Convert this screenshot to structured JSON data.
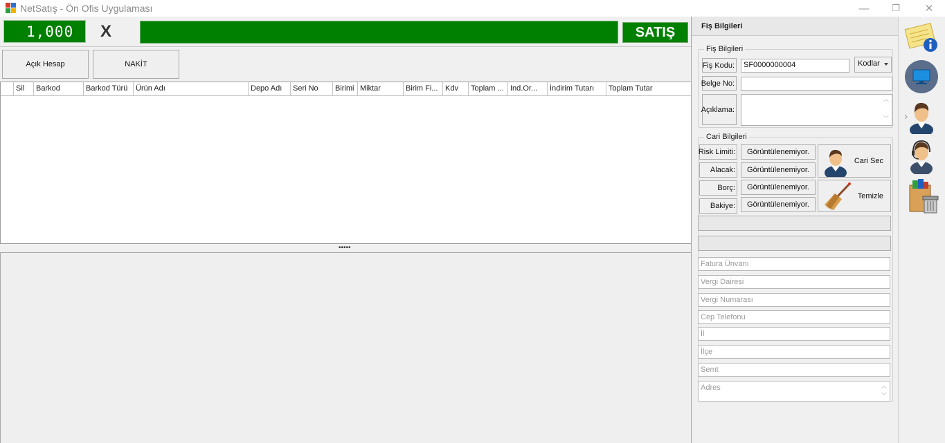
{
  "window": {
    "title": "NetSatış - Ön Ofis Uygulaması",
    "minimize_glyph": "—",
    "restore_glyph": "❐",
    "close_glyph": "✕"
  },
  "sale": {
    "quantity_display": "1,000",
    "multiply_symbol": "X",
    "barcode_value": "",
    "satis_label": "SATIŞ"
  },
  "payment_buttons": [
    "Açık Hesap",
    "NAKİT"
  ],
  "grid": {
    "columns": [
      "",
      "Sil",
      "Barkod",
      "Barkod Türü",
      "Ürün Adı",
      "Depo Adı",
      "Seri No",
      "Birimi",
      "Miktar",
      "Birim Fi...",
      "Kdv",
      "Toplam ...",
      "Ind.Or...",
      "İndirim Tutarı",
      "Toplam Tutar"
    ],
    "rows": []
  },
  "splitter_grip": "•••••",
  "right_panel": {
    "header": "Fiş Bilgileri",
    "fis_group": {
      "title": "Fiş Bilgileri",
      "fis_kodu_label": "Fiş Kodu:",
      "fis_kodu_value": "SF0000000004",
      "kodlar_label": "Kodlar",
      "belge_no_label": "Belge No:",
      "belge_no_value": "",
      "aciklama_label": "Açıklama:",
      "aciklama_value": ""
    },
    "cari_group": {
      "title": "Cari Bilgileri",
      "rows": [
        {
          "label": "Risk Limiti:",
          "value": "Görüntülenemiyor."
        },
        {
          "label": "Alacak:",
          "value": "Görüntülenemiyor."
        },
        {
          "label": "Borç:",
          "value": "Görüntülenemiyor."
        },
        {
          "label": "Bakiye:",
          "value": "Görüntülenemiyor."
        }
      ],
      "cari_sec_label": "Cari Sec",
      "temizle_label": "Temizle"
    },
    "placeholders": {
      "fatura_unvani": "Fatura Ünvanı",
      "vergi_dairesi": "Vergi Dairesi",
      "vergi_numarasi": "Vergi Numarası",
      "cep_telefonu": "Cep Telefonu",
      "il": "İl",
      "ilce": "İlçe",
      "semt": "Semt",
      "adres": "Adres"
    }
  },
  "side_toolbar": [
    "info-note-icon",
    "monitor-icon",
    "user-icon",
    "support-agent-icon",
    "shopping-bag-trash-icon"
  ],
  "colors": {
    "accent_green": "#008000",
    "selected_circle": "#5a6e8c"
  }
}
